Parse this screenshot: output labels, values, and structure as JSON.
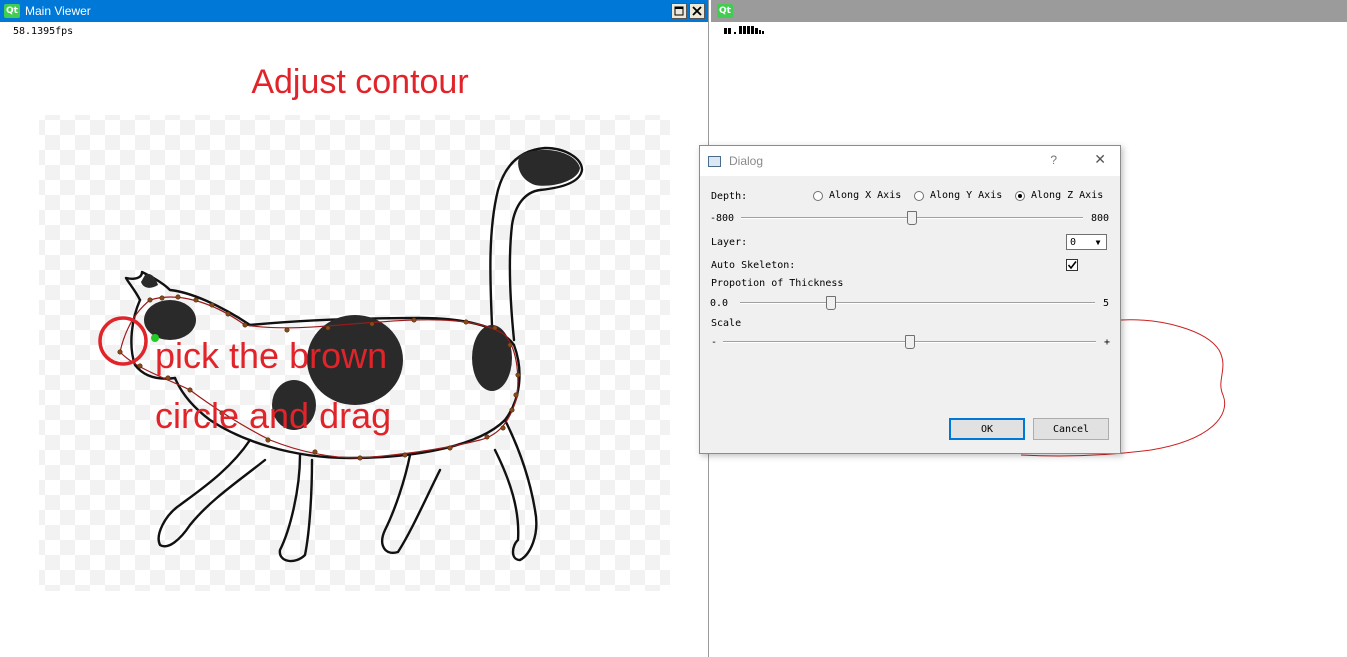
{
  "main_window": {
    "title": "Main Viewer",
    "qt_badge": "Qt",
    "fps": "58.1395fps",
    "annotation_title": "Adjust contour",
    "annotation_line1": "pick the brown",
    "annotation_line2": "circle and drag"
  },
  "second_window": {
    "qt_badge": "Qt"
  },
  "dialog": {
    "title": "Dialog",
    "help": "?",
    "close": "✕",
    "depth_label": "Depth:",
    "radio_x": "Along X Axis",
    "radio_y": "Along Y Axis",
    "radio_z": "Along Z Axis",
    "selected_axis": "Z",
    "depth_min": "-800",
    "depth_max": "800",
    "depth_value": 0.5,
    "layer_label": "Layer:",
    "layer_value": "0",
    "auto_skeleton_label": "Auto Skeleton:",
    "auto_skeleton_checked": true,
    "thickness_label": "Propotion of Thickness",
    "thickness_min": "0.0",
    "thickness_max": "5",
    "thickness_value": 0.25,
    "scale_label": "Scale",
    "scale_min": "-",
    "scale_max": "+",
    "scale_value": 0.5,
    "ok_label": "OK",
    "cancel_label": "Cancel"
  },
  "colors": {
    "titlebar_active": "#0078d7",
    "titlebar_inactive": "#9b9b9b",
    "annotation_red": "#e0242a",
    "contour": "#9c1a1a",
    "control_point": "#8b4a1a",
    "eye_green": "#22cc22"
  }
}
